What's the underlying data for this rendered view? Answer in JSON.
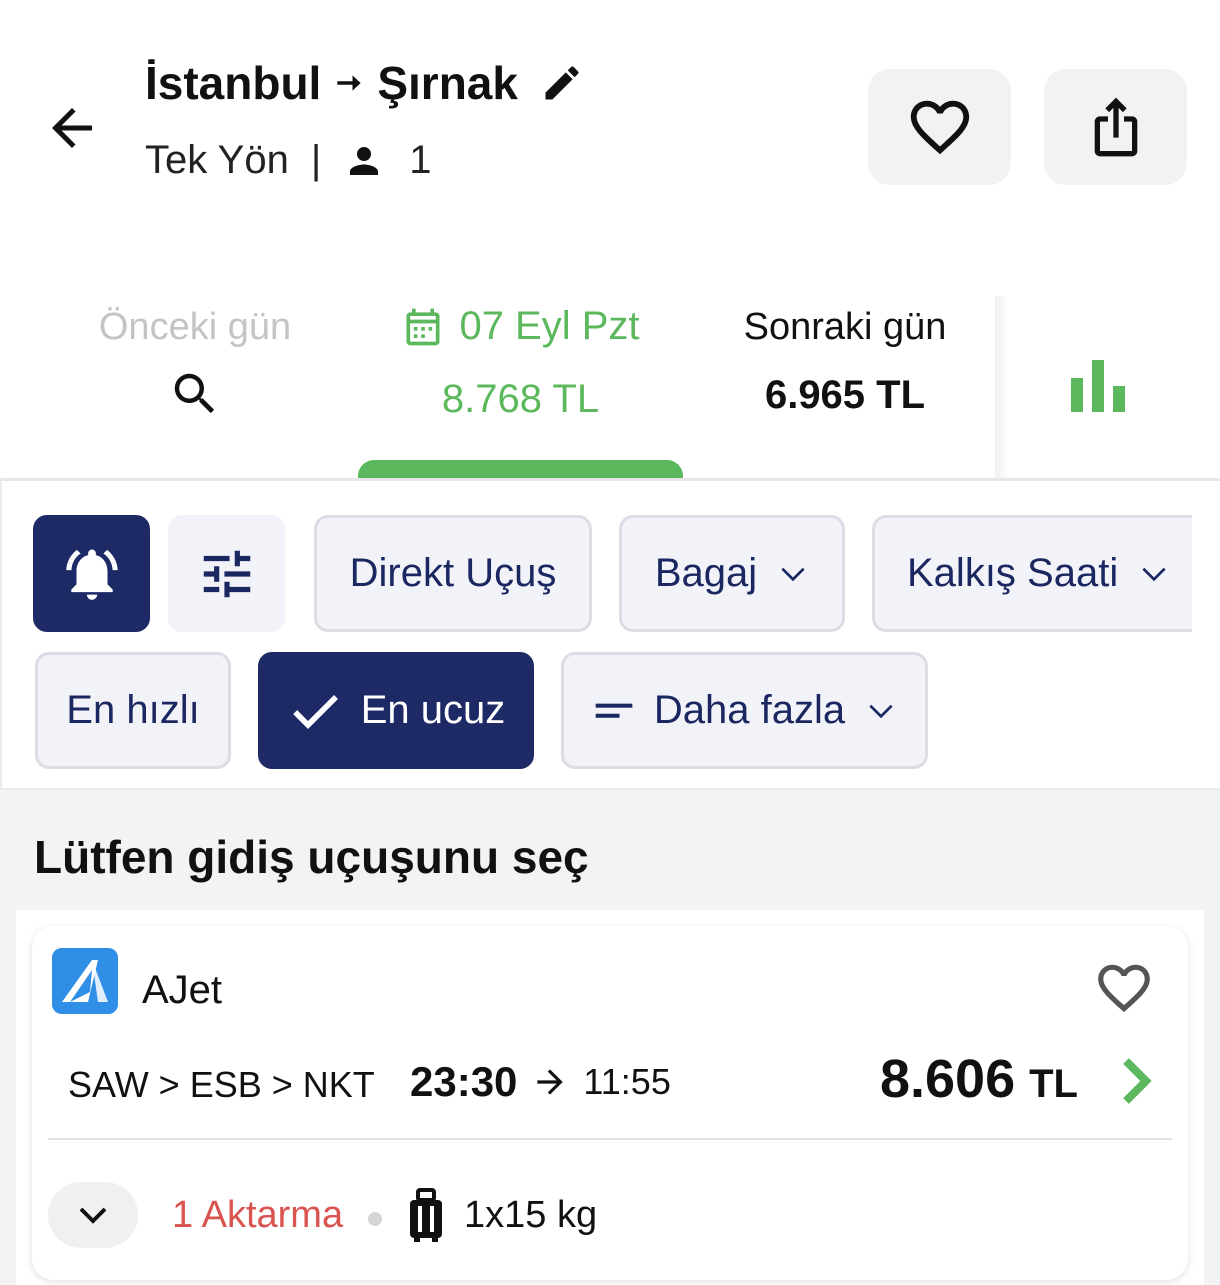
{
  "header": {
    "origin": "İstanbul",
    "destination": "Şırnak",
    "trip_type": "Tek Yön",
    "separator": "|",
    "passengers": "1"
  },
  "date_bar": {
    "prev_label": "Önceki gün",
    "current_date": "07 Eyl Pzt",
    "current_price": "8.768 TL",
    "next_label": "Sonraki gün",
    "next_price": "6.965 TL"
  },
  "filters": {
    "direct": "Direkt Uçuş",
    "baggage": "Bagaj",
    "departure_time": "Kalkış Saati",
    "fastest": "En hızlı",
    "cheapest": "En ucuz",
    "more": "Daha fazla"
  },
  "results": {
    "title": "Lütfen gidiş uçuşunu seç",
    "flights": [
      {
        "airline": "AJet",
        "route": "SAW > ESB > NKT",
        "departure": "23:30",
        "arrival": "11:55",
        "price": "8.606",
        "currency": "TL",
        "stops": "1 Aktarma",
        "baggage": "1x15 kg"
      }
    ]
  },
  "colors": {
    "accent_green": "#5cb85c",
    "navy": "#1e2a66",
    "stops_red": "#d9534f",
    "airline_blue": "#2f8fe6"
  }
}
